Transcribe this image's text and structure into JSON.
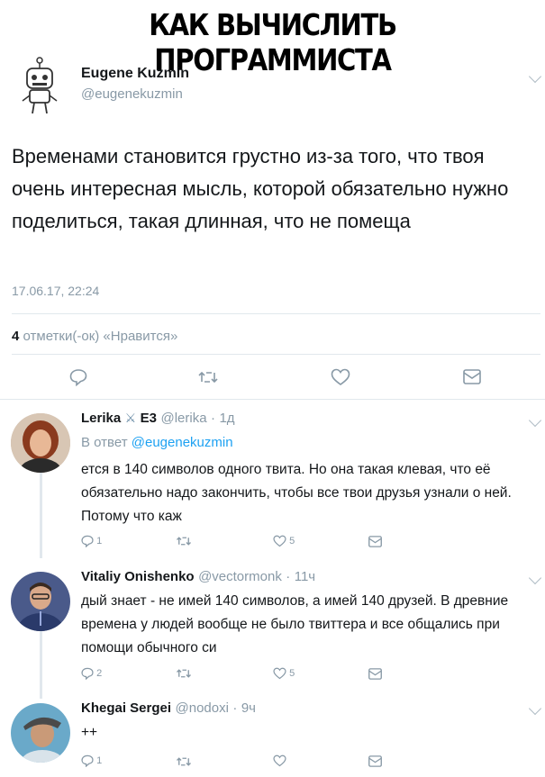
{
  "meme_title": "КАК ВЫЧИСЛИТЬ ПРОГРАММИСТА",
  "main_tweet": {
    "name": "Eugene Kuzmin",
    "handle": "@eugenekuzmin",
    "text": "Временами становится грустно из-за того, что твоя очень интересная мысль, которой обязательно нужно поделиться, такая длинная, что не помеща",
    "date": "17.06.17, 22:24",
    "likes_count": "4",
    "likes_label": "отметки(-ок) «Нравится»"
  },
  "replies": [
    {
      "name": "Lerika",
      "name_suffix": "E3",
      "handle": "@lerika",
      "time": "1д",
      "reply_to_label": "В ответ",
      "reply_to_handle": "@eugenekuzmin",
      "text": "ется в 140 символов одного твита. Но она такая клевая, что её обязательно надо закончить, чтобы все твои друзья узнали о ней. Потому что каж",
      "reply_count": "1",
      "like_count": "5"
    },
    {
      "name": "Vitaliy Onishenko",
      "handle": "@vectormonk",
      "time": "11ч",
      "text": "дый знает - не имей 140 символов, а имей 140 друзей. В древние времена у людей вообще не было твиттера и все общались при помощи обычного си",
      "reply_count": "2",
      "like_count": "5"
    },
    {
      "name": "Khegai Sergei",
      "handle": "@nodoxi",
      "time": "9ч",
      "text": "++",
      "reply_count": "1",
      "like_count": ""
    }
  ],
  "colors": {
    "text": "#14171a",
    "muted": "#8899a6",
    "link": "#1da1f2",
    "divider": "#e1e8ed"
  },
  "icons": [
    "reply-icon",
    "retweet-icon",
    "like-icon",
    "message-icon",
    "chevron-down-icon",
    "robot-avatar"
  ]
}
